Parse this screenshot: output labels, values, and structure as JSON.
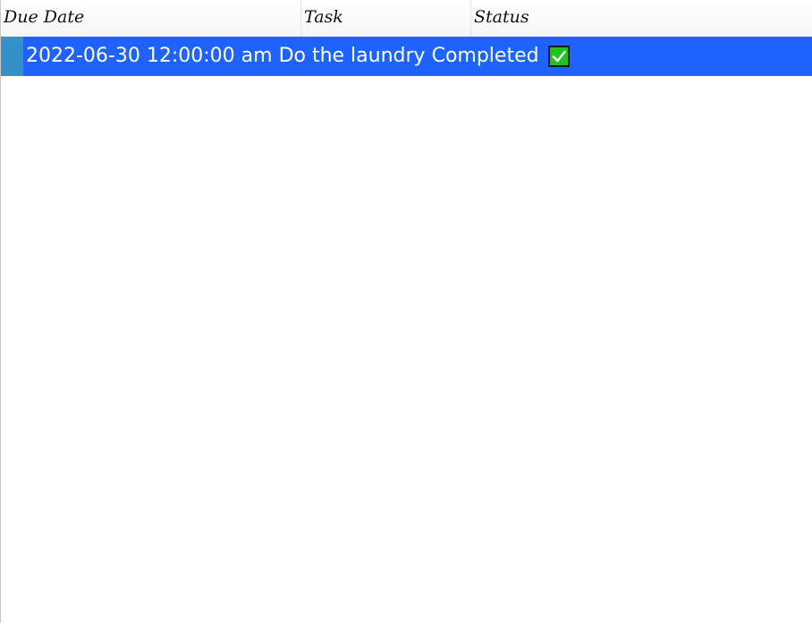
{
  "columns": {
    "due_date": "Due Date",
    "task": "Task",
    "status": "Status"
  },
  "rows": [
    {
      "due_date": "2022-06-30 12:00:00 am",
      "task": "Do the laundry",
      "status": "Completed",
      "status_icon": "check-mark-icon"
    }
  ],
  "colors": {
    "selected_row": "#1e63ff",
    "row_selector": "#3390c8",
    "check_icon": "#1fc51f"
  }
}
